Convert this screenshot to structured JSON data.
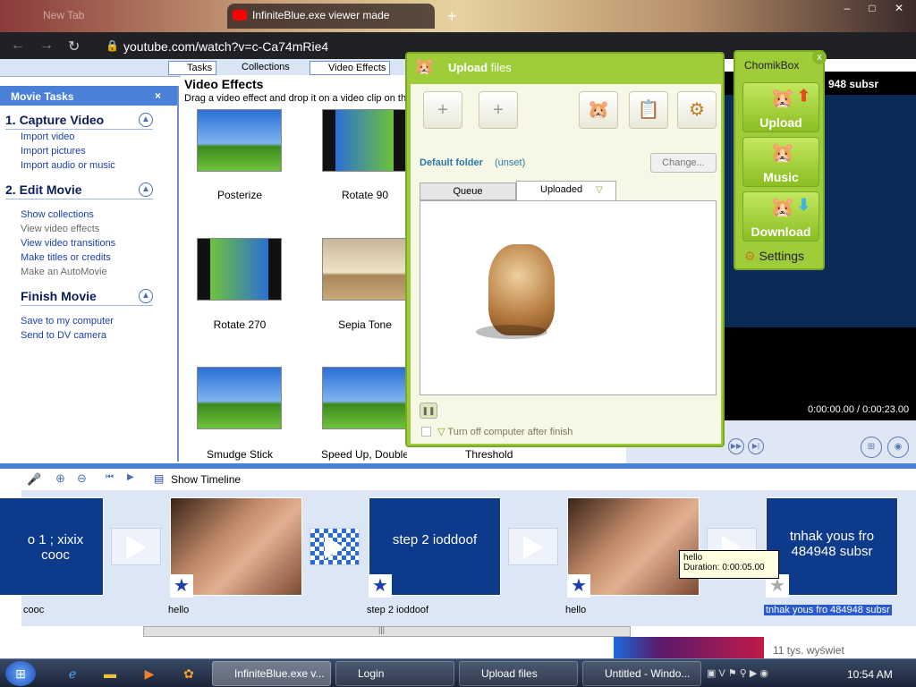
{
  "browser": {
    "tabs": [
      {
        "label": "New Tab",
        "active": false
      },
      {
        "label": "InfiniteBlue.exe viewer made",
        "active": true
      }
    ],
    "new_tab_glyph": "+",
    "url": "youtube.com/watch?v=c-Ca74mRie4"
  },
  "moviemaker": {
    "toolbar": {
      "tasks": "Tasks",
      "collections": "Collections",
      "video_effects": "Video Effects"
    },
    "tasks_pane": {
      "title": "Movie Tasks",
      "close_glyph": "×",
      "sections": [
        {
          "label": "1. Capture Video",
          "items": [
            {
              "label": "Import video",
              "enabled": true
            },
            {
              "label": "Import pictures",
              "enabled": true
            },
            {
              "label": "Import audio or music",
              "enabled": true
            }
          ]
        },
        {
          "label": "2. Edit Movie",
          "items": [
            {
              "label": "Show collections",
              "enabled": true
            },
            {
              "label": "View video effects",
              "enabled": false
            },
            {
              "label": "View video transitions",
              "enabled": true
            },
            {
              "label": "Make titles or credits",
              "enabled": true
            },
            {
              "label": "Make an AutoMovie",
              "enabled": false
            }
          ]
        },
        {
          "label": "Finish Movie",
          "items": [
            {
              "label": "Save to my computer",
              "enabled": true
            },
            {
              "label": "Send to DV camera",
              "enabled": true
            }
          ]
        }
      ]
    },
    "effects": {
      "title": "Video Effects",
      "subtitle": "Drag a video effect and drop it on a video clip on the",
      "items": [
        "Posterize",
        "Rotate 90",
        "Rotate 270",
        "Sepia Tone",
        "Smudge Stick",
        "Speed Up, Double"
      ],
      "threshold_label": "Threshold"
    },
    "player": {
      "title_text": "948 subsr",
      "time": "0:00:00.00 / 0:00:23.00"
    },
    "timeline": {
      "show_timeline": "Show Timeline",
      "clips": [
        {
          "text": "o 1 ; xixix\ncooc",
          "label": "cooc",
          "kind": "title"
        },
        {
          "text": "",
          "label": "hello",
          "kind": "photo"
        },
        {
          "text": "step 2 ioddoof",
          "label": "step 2 ioddoof",
          "kind": "title"
        },
        {
          "text": "",
          "label": "hello",
          "kind": "photo"
        },
        {
          "text": "tnhak yous fro\n484948 subsr",
          "label": "tnhak yous fro 484948 subsr",
          "kind": "title"
        }
      ],
      "tooltip": {
        "name": "hello",
        "duration": "Duration:  0:00:05.00"
      }
    }
  },
  "upload": {
    "title_bold": "Upload",
    "title_rest": " files",
    "default_folder": "Default folder",
    "unset": "(unset)",
    "change": "Change...",
    "tabs": [
      "Queue",
      "Uploaded"
    ],
    "turn_off": "Turn off computer after finish"
  },
  "chomikbox": {
    "title": "ChomikBox",
    "close_glyph": "x",
    "buttons": [
      "Upload",
      "Music",
      "Download"
    ],
    "settings": "Settings"
  },
  "youtube": {
    "views": "11 tys. wyświet"
  },
  "taskbar": {
    "tasks": [
      "InfiniteBlue.exe v...",
      "Login",
      "Upload files",
      "Untitled - Windo..."
    ],
    "clock": "10:54 AM"
  },
  "colors": {
    "upload_green": "#9fcd3a",
    "mm_blue": "#4a80d8",
    "link_blue": "#1a3fa8"
  }
}
